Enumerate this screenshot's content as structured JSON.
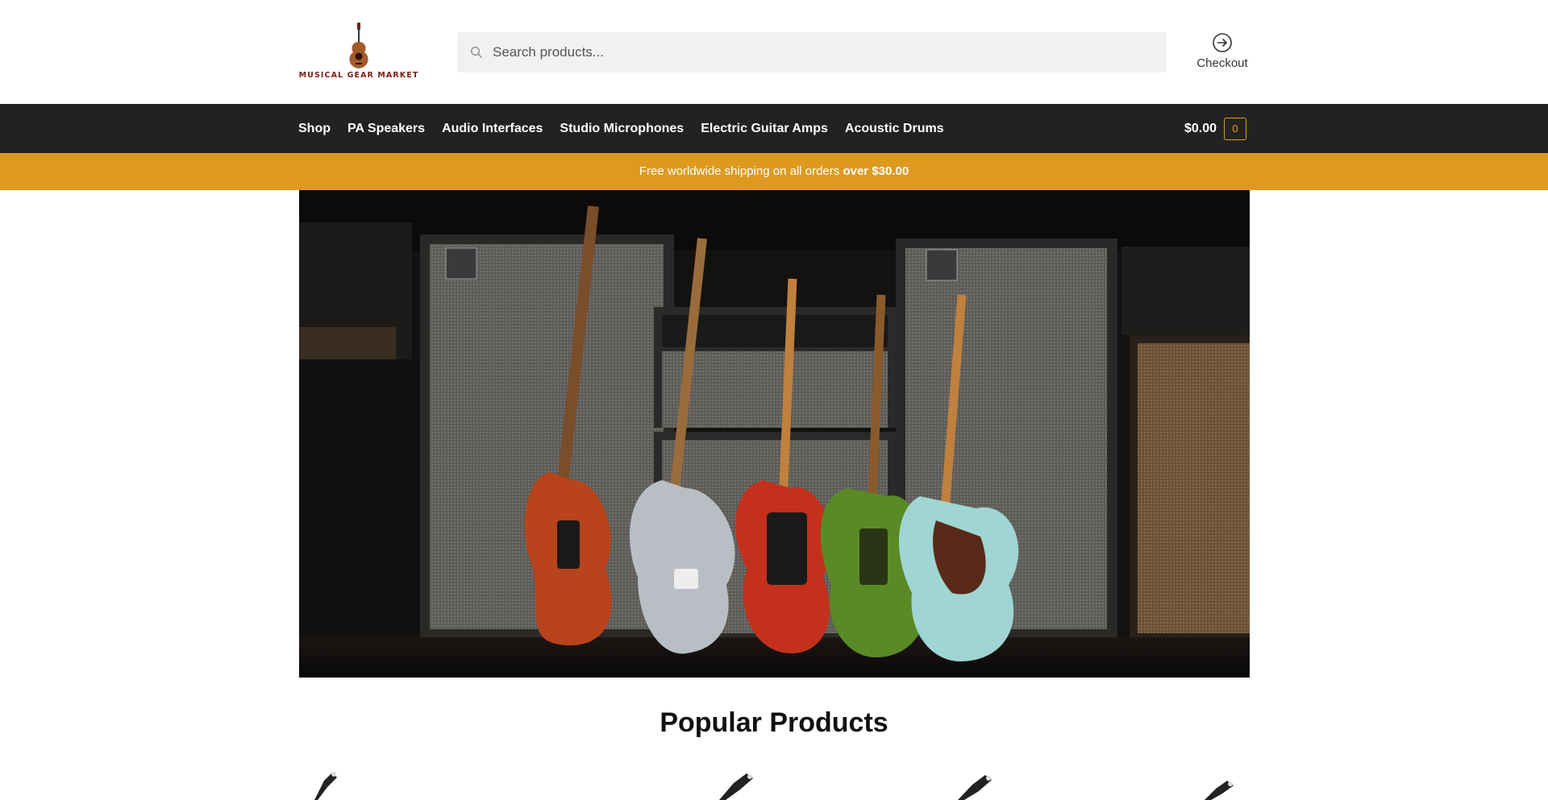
{
  "header": {
    "logo_text": "MUSICAL GEAR MARKET",
    "search": {
      "placeholder": "Search products...",
      "value": ""
    },
    "checkout_label": "Checkout"
  },
  "nav": {
    "items": [
      {
        "label": "Shop"
      },
      {
        "label": "PA Speakers"
      },
      {
        "label": "Audio Interfaces"
      },
      {
        "label": "Studio Microphones"
      },
      {
        "label": "Electric Guitar Amps"
      },
      {
        "label": "Acoustic Drums"
      }
    ],
    "cart_total": "$0.00",
    "cart_count": "0"
  },
  "promo": {
    "text": "Free worldwide shipping on all orders",
    "highlight": "over $30.00"
  },
  "hero": {
    "description": "Row of five Music Man bass and electric guitars leaning against amplifier cabinets"
  },
  "popular": {
    "title": "Popular Products"
  },
  "colors": {
    "nav_background": "#222222",
    "accent": "#dd9a1f",
    "logo": "#7a1f12"
  },
  "icons": {
    "search": "search-icon",
    "checkout": "arrow-circle-right-icon",
    "logo": "guitar-logo"
  }
}
